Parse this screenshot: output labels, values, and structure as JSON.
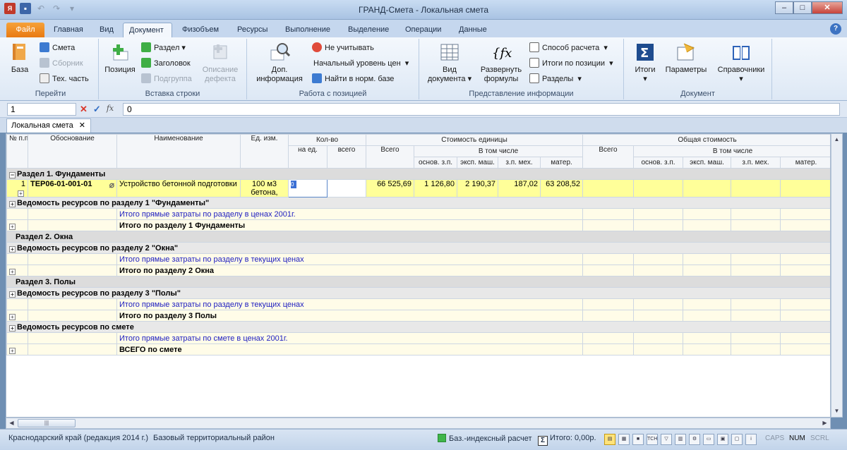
{
  "window": {
    "title": "ГРАНД-Смета - Локальная смета",
    "minimize": "–",
    "maximize": "□",
    "close": "✕"
  },
  "ribbon_tabs": [
    "Файл",
    "Главная",
    "Вид",
    "Документ",
    "Физобъем",
    "Ресурсы",
    "Выполнение",
    "Выделение",
    "Операции",
    "Данные"
  ],
  "ribbon": {
    "go": {
      "label": "Перейти",
      "baza": "База",
      "smeta": "Смета",
      "sbornik": "Сборник",
      "tech": "Тех. часть"
    },
    "insert": {
      "label": "Вставка строки",
      "pozitsiya": "Позиция",
      "razdel": "Раздел",
      "zagolovok": "Заголовок",
      "podgruppa": "Подгруппа",
      "opisanie": "Описание дефекта"
    },
    "work": {
      "label": "Работа с позицией",
      "dop": "Доп. информация",
      "ne_uchit": "Не учитывать",
      "nach_uroven": "Начальный уровень цен",
      "naiti": "Найти в норм. базе"
    },
    "view": {
      "label": "Представление информации",
      "vid_doc": "Вид документа",
      "razvernut": "Развернуть формулы",
      "sposob": "Способ расчета",
      "itogi_poz": "Итоги по позиции",
      "razdely": "Разделы"
    },
    "doc": {
      "label": "Документ",
      "itogi": "Итоги",
      "parametry": "Параметры",
      "spravochniki": "Справочники"
    }
  },
  "formula_bar": {
    "cell": "1",
    "value": "0",
    "fx": "fx"
  },
  "doc_tab": {
    "label": "Локальная смета",
    "close": "✕"
  },
  "headers": {
    "num": "№ п.п",
    "obosn": "Обоснование",
    "naim": "Наименование",
    "ed": "Ед. изм.",
    "kolvo": "Кол-во",
    "na_ed": "на ед.",
    "vsego": "всего",
    "stoim_ed": "Стоимость единицы",
    "obsh_stoim": "Общая стоимость",
    "vsego2": "Всего",
    "v_tom_chisle": "В том числе",
    "osnov": "основ. з.п.",
    "eksp": "эксп. маш.",
    "zp_meh": "з.п. мех.",
    "mater": "матер.",
    "vsego3": "Всего",
    "v_tom_chisle2": "В том числе",
    "osnov2": "основ. з.п.",
    "eksp2": "эксп. маш.",
    "zp_meh2": "з.п. мех.",
    "mater2": "матер."
  },
  "rows": {
    "r1": "Раздел 1. Фундаменты",
    "pos1": {
      "num": "1",
      "code": "ТЕР06-01-001-01",
      "name": "Устройство бетонной подготовки",
      "unit": "100 м3 бетона,",
      "qty": "0",
      "total": "66 525,69",
      "osnov": "1 126,80",
      "eksp": "2 190,37",
      "zpmeh": "187,02",
      "mater": "63 208,52"
    },
    "ved1": "Ведомость ресурсов по разделу 1 \"Фундаменты\"",
    "itog1_direct": "Итого прямые затраты по разделу в ценах 2001г.",
    "itog1": "Итого по разделу 1 Фундаменты",
    "r2": "Раздел 2. Окна",
    "ved2": "Ведомость ресурсов по разделу 2 \"Окна\"",
    "itog2_direct": "Итого прямые затраты по разделу в текущих ценах",
    "itog2": "Итого по разделу 2 Окна",
    "r3": "Раздел 3. Полы",
    "ved3": "Ведомость ресурсов по разделу 3 \"Полы\"",
    "itog3_direct": "Итого прямые затраты по разделу в текущих ценах",
    "itog3": "Итого по разделу 3 Полы",
    "ved_all": "Ведомость ресурсов по смете",
    "itog_all_direct": "Итого прямые затраты по смете в ценах 2001г.",
    "vsego_smeta": "ВСЕГО по смете"
  },
  "status": {
    "region": "Краснодарский край (редакция 2014 г.)",
    "district": "Базовый территориальный район",
    "calc": "Баз.-индексный расчет",
    "itogo": "Итого: 0,00р.",
    "caps": "CAPS",
    "num": "NUM",
    "scrl": "SCRL"
  }
}
